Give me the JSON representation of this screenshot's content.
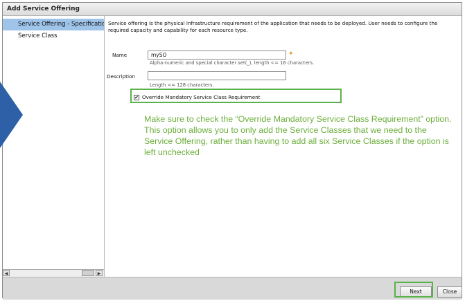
{
  "window": {
    "title": "Add Service Offering"
  },
  "sidebar": {
    "items": [
      {
        "label": "Service Offering - Specification"
      },
      {
        "label": "Service Class"
      }
    ]
  },
  "content": {
    "description": "Service offering is the physical infrastructure requirement of the application that needs to be deployed. User needs to configure the required capacity and capability for each resource type.",
    "name_field": {
      "label": "Name",
      "value": "mySO",
      "hint": "Alpha-numeric and special character set(_), length <= 16 characters.",
      "required_mark": "✦"
    },
    "description_field": {
      "label": "Description",
      "value": "",
      "hint": "Length <= 128 characters."
    },
    "override_checkbox": {
      "label": "Override Mandatory Service Class Requirement",
      "checked": true,
      "check_glyph": "✔"
    }
  },
  "annotation": {
    "text": "Make sure to check the “Override Mandatory Service Class Requirement” option. This option allows you to only add the Service Classes that we need to the Service Offering, rather than having to add all six Service Classes if the option is left unchecked"
  },
  "buttons": {
    "next": "Next",
    "close": "Close"
  },
  "scroll": {
    "left_arrow": "◀",
    "right_arrow": "▶"
  },
  "colors": {
    "highlight_green": "#5cb24a",
    "annotation_green": "#6cae3c",
    "sidebar_selected": "#9fc4ea",
    "arrow_blue": "#2d60a6",
    "required_orange": "#e8902a"
  }
}
